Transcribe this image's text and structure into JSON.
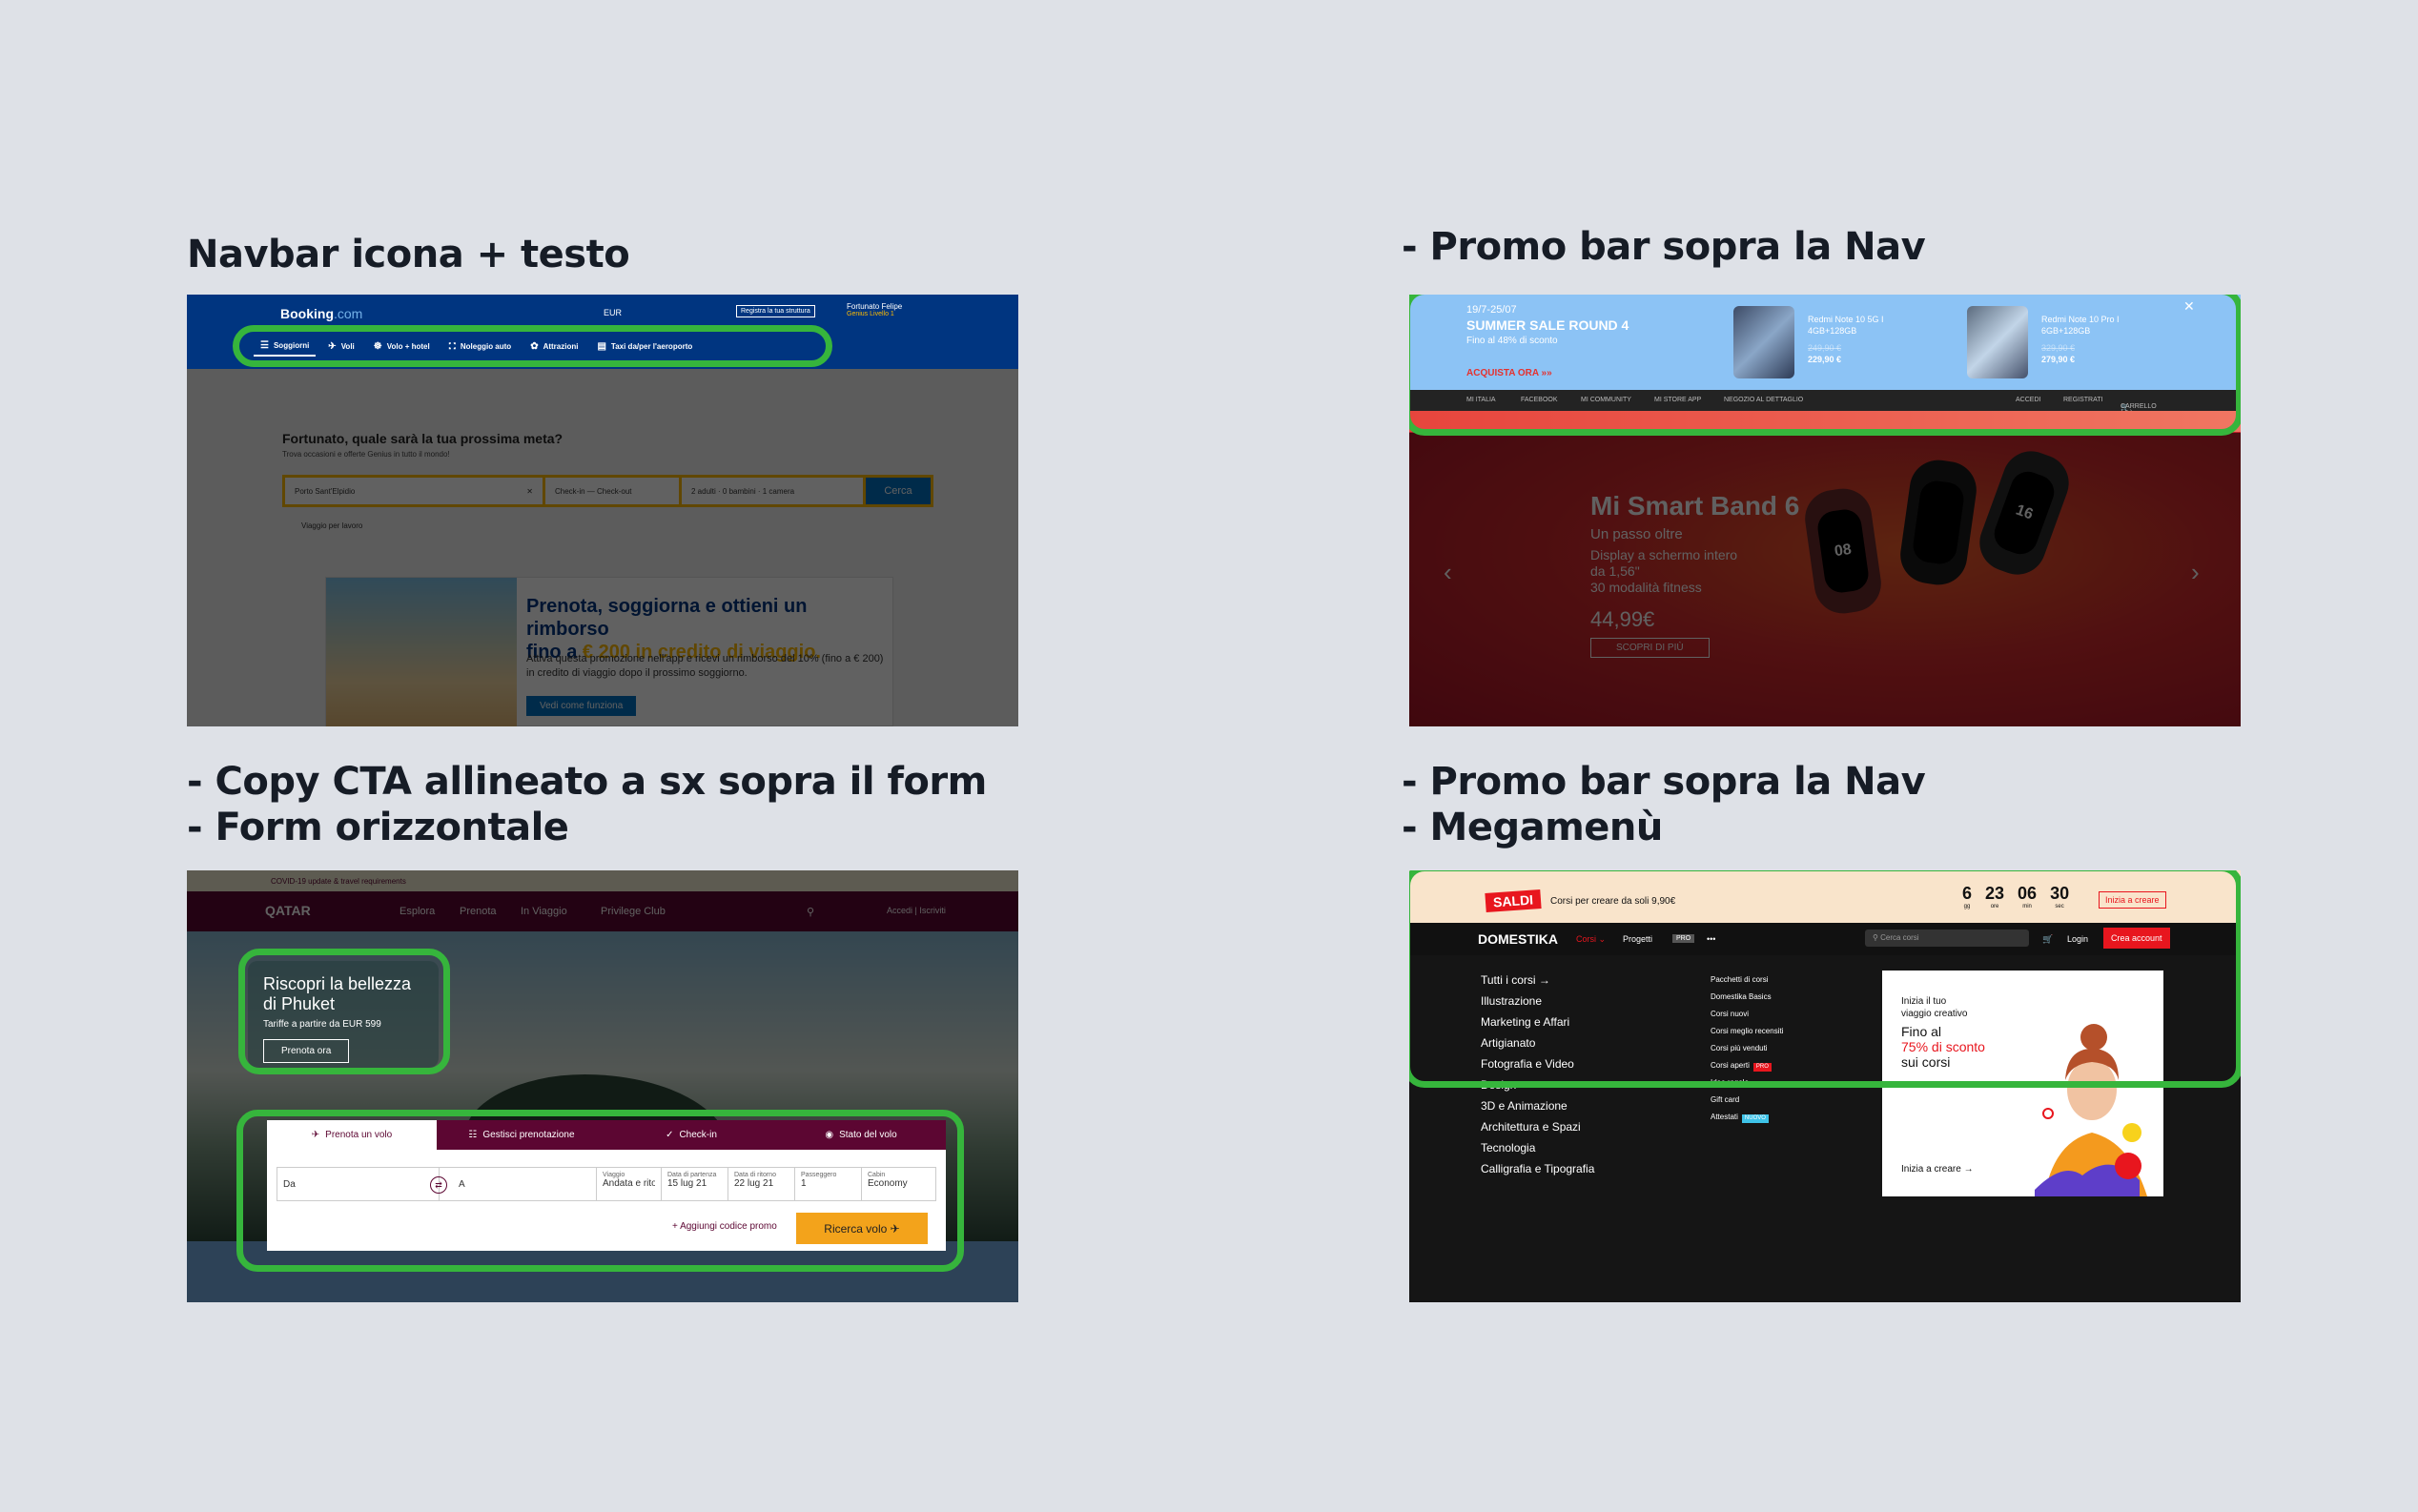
{
  "sections": {
    "booking_title": "Navbar icona + testo",
    "mi_title": "- Promo bar sopra la Nav",
    "qatar_title": "- Copy CTA allineato a sx sopra il form\n- Form orizzontale",
    "domestika_title": "- Promo bar sopra la Nav\n- Megamenù"
  },
  "booking": {
    "logo": "Booking",
    "logo_suffix": ".com",
    "currency": "EUR",
    "register": "Registra la tua struttura",
    "user_name": "Fortunato Felipe",
    "user_level": "Genius Livello 1",
    "nav": [
      {
        "label": "Soggiorni",
        "icon": "bed-icon"
      },
      {
        "label": "Voli",
        "icon": "plane-icon"
      },
      {
        "label": "Volo + hotel",
        "icon": "plane-hotel-icon"
      },
      {
        "label": "Noleggio auto",
        "icon": "car-icon"
      },
      {
        "label": "Attrazioni",
        "icon": "attraction-icon"
      },
      {
        "label": "Taxi da/per l'aeroporto",
        "icon": "taxi-icon"
      }
    ],
    "question": "Fortunato, quale sarà la tua prossima meta?",
    "subtitle": "Trova occasioni e offerte Genius in tutto il mondo!",
    "destination": "Porto Sant'Elpidio",
    "checkin": "Check-in",
    "checkout": "Check-out",
    "guests": "2 adulti · 0 bambini · 1 camera",
    "search": "Cerca",
    "work_trip": "Viaggio per lavoro",
    "promo_title": "Prenota, soggiorna e ottieni un rimborso",
    "promo_title_2": "fino a",
    "promo_highlight": "€ 200 in credito di viaggio.",
    "promo_body": "Attiva questa promozione nell'app e ricevi un rimborso del 10% (fino a € 200) in credito di viaggio dopo il prossimo soggiorno.",
    "promo_btn": "Vedi come funziona"
  },
  "mi": {
    "date": "19/7-25/07",
    "title": "SUMMER SALE ROUND 4",
    "sub": "Fino al 48% di sconto",
    "cta": "ACQUISTA ORA",
    "phone1": {
      "name": "Redmi Note 10 5G I",
      "spec": "4GB+128GB",
      "old": "249,90 €",
      "new": "229,90 €"
    },
    "phone2": {
      "name": "Redmi Note 10 Pro I",
      "spec": "6GB+128GB",
      "old": "329,90 €",
      "new": "279,90 €"
    },
    "nav_left": [
      "MI ITALIA",
      "FACEBOOK",
      "MI COMMUNITY",
      "MI STORE APP",
      "NEGOZIO AL DETTAGLIO"
    ],
    "nav_right": [
      "ACCEDI",
      "REGISTRATI",
      "CARRELLO ( 0 )"
    ],
    "hero_title": "Mi Smart Band 6",
    "hero_sub": "Un passo oltre",
    "hero_desc_1": "Display a schermo intero",
    "hero_desc_2": "da 1,56\"",
    "hero_desc_3": "30 modalità fitness",
    "hero_price": "44,99€",
    "hero_btn": "SCOPRI DI PIÙ",
    "watch_time_1": "08",
    "watch_time_2": "16"
  },
  "qatar": {
    "covid": "COVID-19 update & travel requirements",
    "logo": "QATAR",
    "nav": [
      "Esplora",
      "Prenota",
      "In Viaggio",
      "Privilege Club"
    ],
    "login": "Accedi | Iscriviti",
    "card_title": "Riscopri la bellezza di Phuket",
    "card_sub": "Tariffe a partire da EUR 599",
    "card_btn": "Prenota ora",
    "tabs": [
      "Prenota un volo",
      "Gestisci prenotazione",
      "Check-in",
      "Stato del volo"
    ],
    "from": "Da",
    "to": "A",
    "trip_label": "Viaggio",
    "trip_value": "Andata e ritorno",
    "dep_label": "Data di partenza",
    "dep_value": "15 lug 21",
    "ret_label": "Data di ritorno",
    "ret_value": "22 lug 21",
    "pax_label": "Passeggero",
    "pax_value": "1",
    "cabin_label": "Cabin",
    "cabin_value": "Economy",
    "promo": "+ Aggiungi codice promo",
    "search": "Ricerca volo"
  },
  "domestika": {
    "saldi": "SALDI",
    "promo": "Corsi per creare da soli 9,90€",
    "countdown": [
      {
        "v": "6",
        "u": "gg"
      },
      {
        "v": "23",
        "u": "ore"
      },
      {
        "v": "06",
        "u": "min"
      },
      {
        "v": "30",
        "u": "sec"
      }
    ],
    "promo_btn": "Inizia a creare",
    "logo": "DOMESTIKA",
    "nav": [
      "Corsi",
      "Progetti",
      "PRO"
    ],
    "search": "Cerca corsi",
    "login": "Login",
    "create": "Crea account",
    "col1": [
      "Tutti i corsi →",
      "Illustrazione",
      "Marketing e Affari",
      "Artigianato",
      "Fotografia e Video",
      "Design",
      "3D e Animazione",
      "Architettura e Spazi",
      "Tecnologia",
      "Calligrafia e Tipografia"
    ],
    "col2": [
      "Pacchetti di corsi",
      "Domestika Basics",
      "Corsi nuovi",
      "Corsi meglio recensiti",
      "Corsi più venduti",
      "Corsi aperti",
      "Idee regalo",
      "Gift card",
      "Attestati"
    ],
    "badge_pro": "PRO",
    "badge_new": "NUOVO",
    "card_line1": "Inizia il tuo",
    "card_line2": "viaggio creativo",
    "card_big1": "Fino al",
    "card_big2": "75% di sconto",
    "card_big3": "sui corsi",
    "card_cta": "Inizia a creare →"
  },
  "colors": {
    "highlight": "#36b53c",
    "booking_blue": "#003580",
    "qatar_burgundy": "#5c0632",
    "domestika_red": "#e8161e"
  }
}
